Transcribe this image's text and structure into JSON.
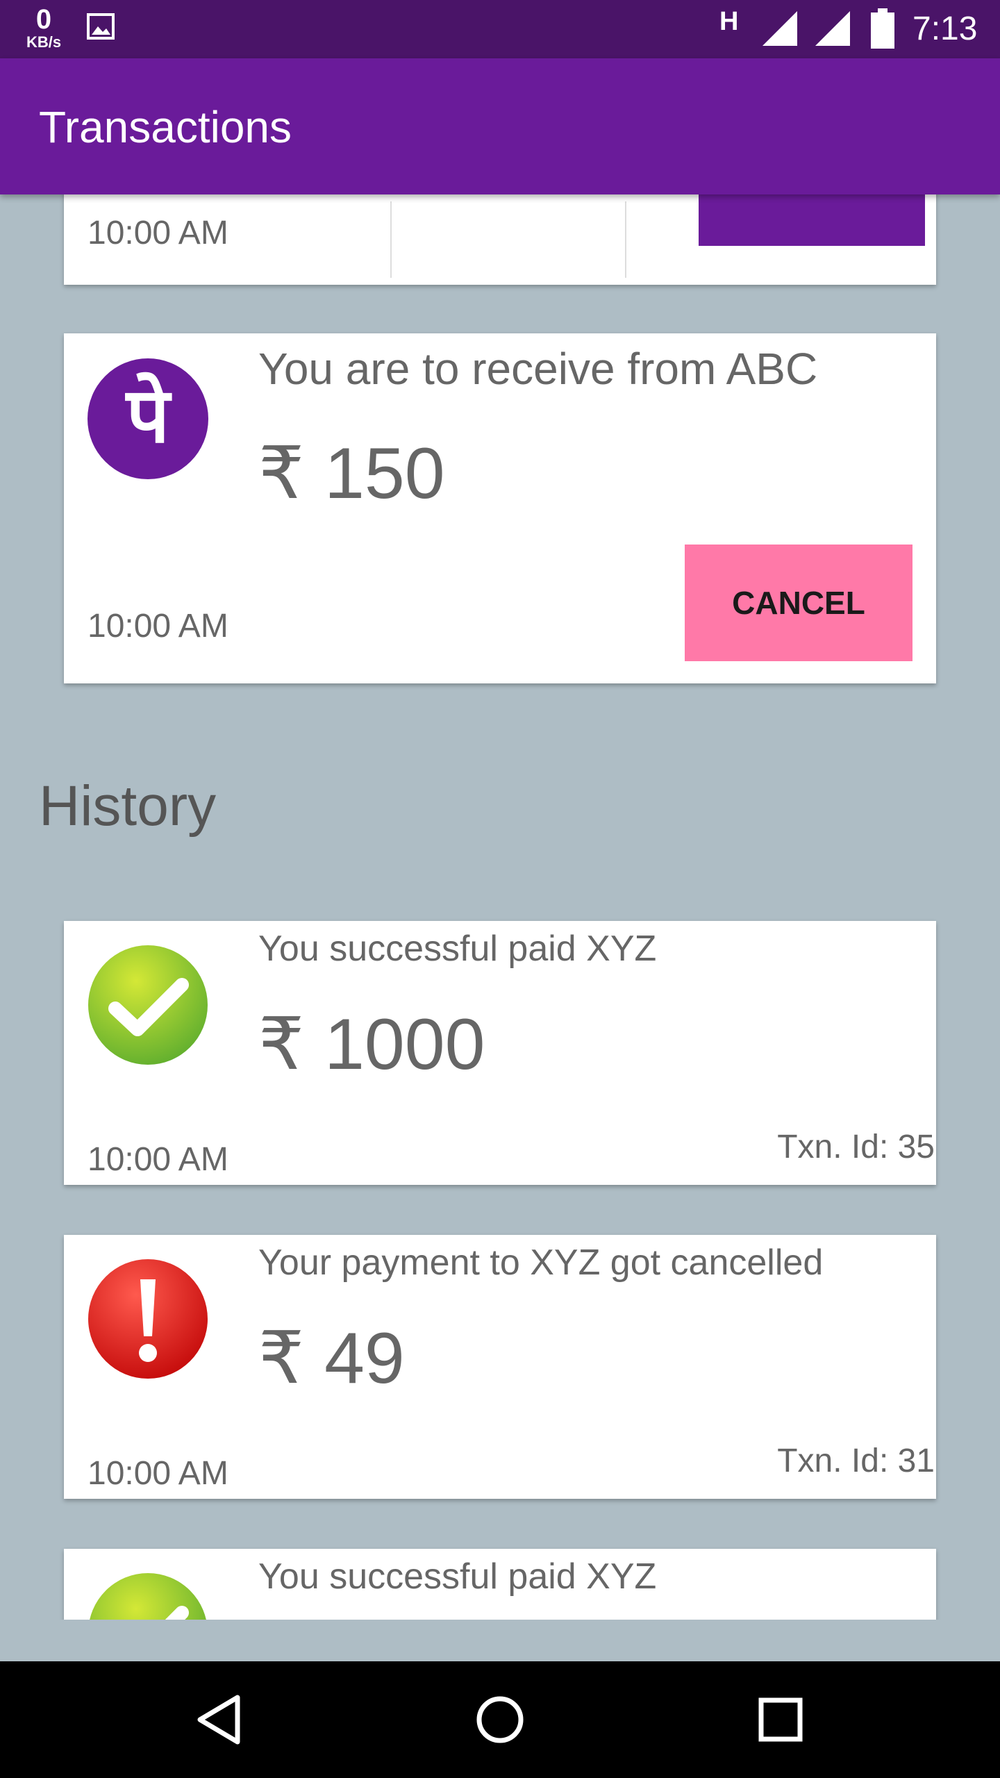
{
  "status_bar": {
    "speed_value": "0",
    "speed_unit": "KB/s",
    "network_type": "H",
    "time": "7:13",
    "icons": [
      "image-icon",
      "signal-icon",
      "signal-icon",
      "battery-icon"
    ]
  },
  "app_bar": {
    "title": "Transactions"
  },
  "partial_top_card": {
    "time": "10:00 AM"
  },
  "pending_card": {
    "title": "You are to receive from ABC",
    "amount": "₹ 150",
    "time": "10:00 AM",
    "cancel_label": "CANCEL",
    "logo_glyph": "पे",
    "colors": {
      "logo": "#6A1B9A",
      "cancel": "#FF79A8"
    }
  },
  "history": {
    "heading": "History",
    "items": [
      {
        "title": "You successful paid XYZ",
        "amount": "₹ 1000",
        "time": "10:00 AM",
        "txn": "Txn. Id: 35",
        "status_icon": "check-icon"
      },
      {
        "title": "Your payment to XYZ got cancelled",
        "amount": "₹ 49",
        "time": "10:00 AM",
        "txn": "Txn. Id: 31",
        "status_icon": "alert-icon"
      },
      {
        "title": "You successful paid XYZ",
        "status_icon": "check-icon"
      }
    ]
  },
  "nav_bar": {
    "buttons": [
      "back-icon",
      "home-icon",
      "recents-icon"
    ]
  },
  "colors": {
    "primary": "#6A1B9A",
    "primary_dark": "#4A1468",
    "background": "#AEBDC5",
    "success": "#8BC34A",
    "error": "#E53935"
  }
}
